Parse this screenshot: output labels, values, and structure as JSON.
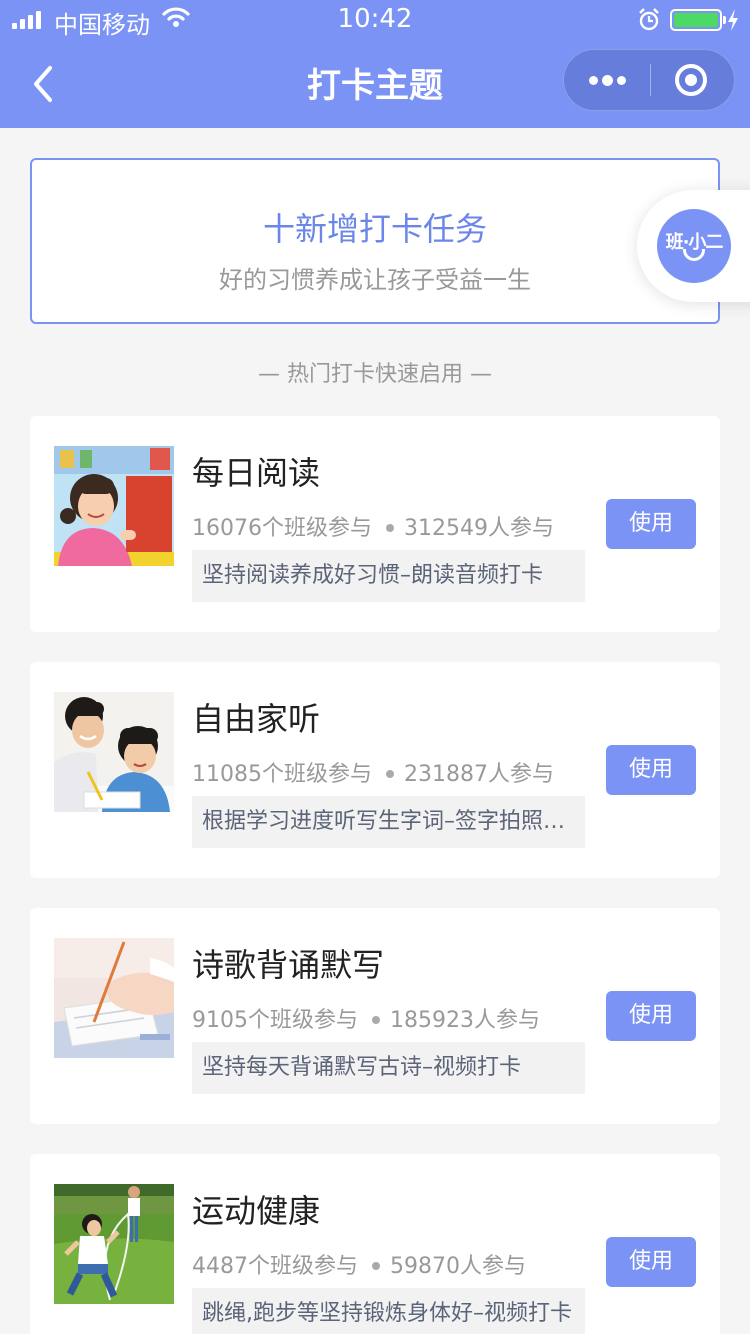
{
  "status_bar": {
    "carrier": "中国移动",
    "time": "10:42"
  },
  "nav": {
    "title": "打卡主题"
  },
  "add_task": {
    "title": "十新增打卡任务",
    "subtitle": "好的习惯养成让孩子受益一生"
  },
  "mascot": {
    "text": "班·小二"
  },
  "section": {
    "title": "— 热门打卡快速启用 —"
  },
  "use_label": "使用",
  "themes": [
    {
      "name": "每日阅读",
      "classes": "16076个班级参与",
      "people": "312549人参与",
      "desc": "坚持阅读养成好习惯–朗读音频打卡"
    },
    {
      "name": "自由家听",
      "classes": "11085个班级参与",
      "people": "231887人参与",
      "desc": "根据学习进度听写生字词–签字拍照打卡"
    },
    {
      "name": "诗歌背诵默写",
      "classes": "9105个班级参与",
      "people": "185923人参与",
      "desc": "坚持每天背诵默写古诗–视频打卡"
    },
    {
      "name": "运动健康",
      "classes": "4487个班级参与",
      "people": "59870人参与",
      "desc": "跳绳,跑步等坚持锻炼身体好–视频打卡"
    }
  ],
  "colors": {
    "primary": "#7b93f5",
    "background": "#f5f5f5"
  }
}
